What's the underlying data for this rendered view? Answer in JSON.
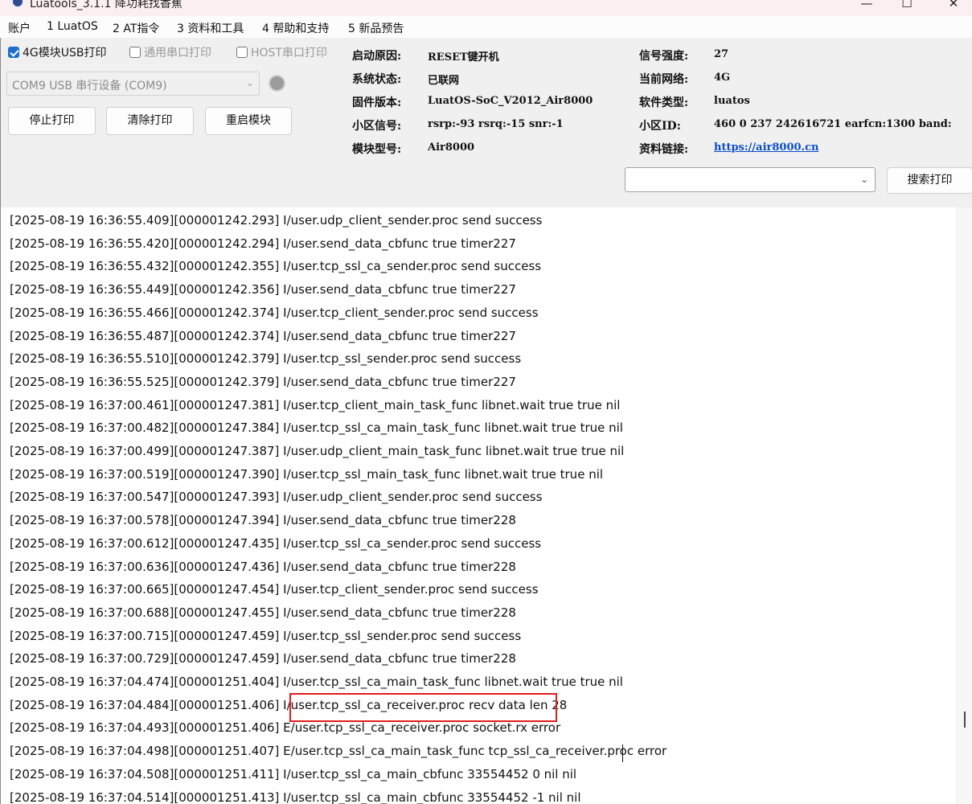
{
  "window": {
    "title": "Luatools_3.1.1 降功耗找香蕉",
    "minimize_glyph": "—",
    "maximize_glyph": "☐",
    "close_glyph": "✕"
  },
  "menu": [
    "账户",
    "1 LuatOS",
    "2 AT指令",
    "3 资料和工具",
    "4 帮助和支持",
    "5 新品预告"
  ],
  "print_options": {
    "usb_4g": {
      "label": "4G模块USB打印",
      "checked": true
    },
    "serial": {
      "label": "通用串口打印",
      "checked": false
    },
    "host": {
      "label": "HOST串口打印",
      "checked": false
    }
  },
  "port": {
    "value": "COM9 USB 串行设备 (COM9)"
  },
  "buttons": {
    "stop": "停止打印",
    "clear": "清除打印",
    "restart": "重启模块",
    "search": "搜索打印"
  },
  "info": {
    "boot_reason": {
      "label": "启动原因:",
      "value": "RESET键开机"
    },
    "system_state": {
      "label": "系统状态:",
      "value": "已联网"
    },
    "firmware": {
      "label": "固件版本:",
      "value": "LuatOS-SoC_V2012_Air8000"
    },
    "cell_signal": {
      "label": "小区信号:",
      "value": "rsrp:-93 rsrq:-15 snr:-1"
    },
    "module_model": {
      "label": "模块型号:",
      "value": "Air8000"
    },
    "signal_strength": {
      "label": "信号强度:",
      "value": "27"
    },
    "current_network": {
      "label": "当前网络:",
      "value": "4G"
    },
    "software_type": {
      "label": "软件类型:",
      "value": "luatos"
    },
    "cell_id": {
      "label": "小区ID:",
      "value": "460 0 237 242616721 earfcn:1300 band:"
    },
    "doc_link": {
      "label": "资料链接:",
      "value": "https://air8000.cn"
    }
  },
  "search": {
    "value": ""
  },
  "log_lines": [
    "[2025-08-19 16:36:55.409][000001242.293] I/user.udp_client_sender.proc send success",
    "[2025-08-19 16:36:55.420][000001242.294] I/user.send_data_cbfunc true timer227",
    "[2025-08-19 16:36:55.432][000001242.355] I/user.tcp_ssl_ca_sender.proc send success",
    "[2025-08-19 16:36:55.449][000001242.356] I/user.send_data_cbfunc true timer227",
    "[2025-08-19 16:36:55.466][000001242.374] I/user.tcp_client_sender.proc send success",
    "[2025-08-19 16:36:55.487][000001242.374] I/user.send_data_cbfunc true timer227",
    "[2025-08-19 16:36:55.510][000001242.379] I/user.tcp_ssl_sender.proc send success",
    "[2025-08-19 16:36:55.525][000001242.379] I/user.send_data_cbfunc true timer227",
    "[2025-08-19 16:37:00.461][000001247.381] I/user.tcp_client_main_task_func libnet.wait true true nil",
    "[2025-08-19 16:37:00.482][000001247.384] I/user.tcp_ssl_ca_main_task_func libnet.wait true true nil",
    "[2025-08-19 16:37:00.499][000001247.387] I/user.udp_client_main_task_func libnet.wait true true nil",
    "[2025-08-19 16:37:00.519][000001247.390] I/user.tcp_ssl_main_task_func libnet.wait true true nil",
    "[2025-08-19 16:37:00.547][000001247.393] I/user.udp_client_sender.proc send success",
    "[2025-08-19 16:37:00.578][000001247.394] I/user.send_data_cbfunc true timer228",
    "[2025-08-19 16:37:00.612][000001247.435] I/user.tcp_ssl_ca_sender.proc send success",
    "[2025-08-19 16:37:00.636][000001247.436] I/user.send_data_cbfunc true timer228",
    "[2025-08-19 16:37:00.665][000001247.454] I/user.tcp_client_sender.proc send success",
    "[2025-08-19 16:37:00.688][000001247.455] I/user.send_data_cbfunc true timer228",
    "[2025-08-19 16:37:00.715][000001247.459] I/user.tcp_ssl_sender.proc send success",
    "[2025-08-19 16:37:00.729][000001247.459] I/user.send_data_cbfunc true timer228",
    "[2025-08-19 16:37:04.474][000001251.404] I/user.tcp_ssl_ca_main_task_func libnet.wait true true nil",
    "[2025-08-19 16:37:04.484][000001251.406] I/user.tcp_ssl_ca_receiver.proc recv data len 28",
    "[2025-08-19 16:37:04.493][000001251.406] E/user.tcp_ssl_ca_receiver.proc socket.rx error",
    "[2025-08-19 16:37:04.498][000001251.407] E/user.tcp_ssl_ca_main_task_func tcp_ssl_ca_receiver.proc error",
    "[2025-08-19 16:37:04.508][000001251.411] I/user.tcp_ssl_ca_main_cbfunc 33554452 0 nil nil",
    "[2025-08-19 16:37:04.514][000001251.413] I/user.tcp_ssl_ca_main_cbfunc 33554452 -1 nil nil"
  ],
  "highlighted_line_index": 21,
  "colors": {
    "highlight_border": "#e21b1b",
    "link": "#0b4fc7",
    "checkbox_checked": "#1e6ecb"
  }
}
